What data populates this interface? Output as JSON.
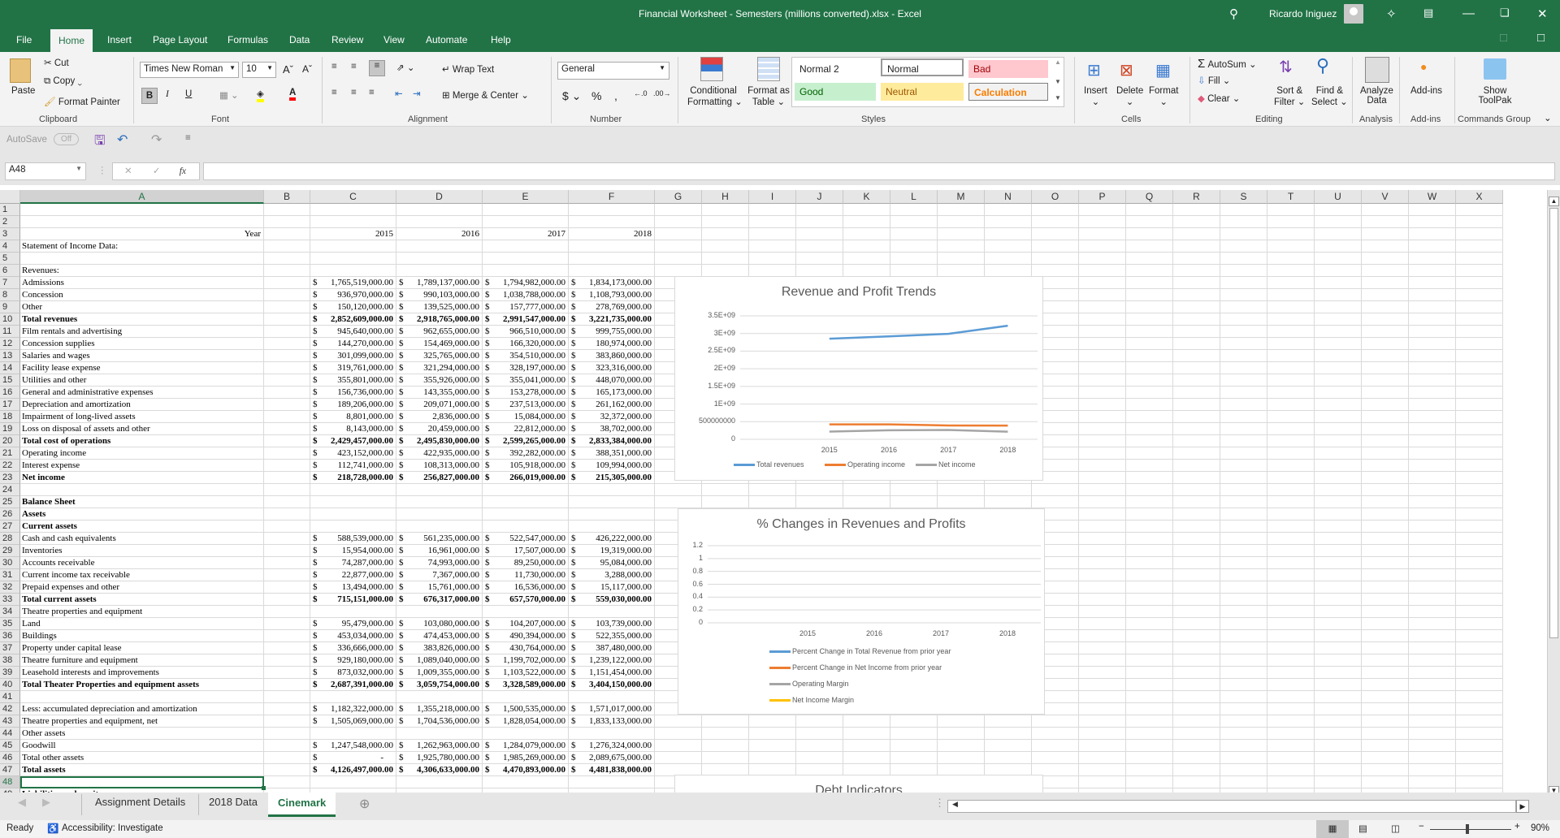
{
  "titlebar": {
    "title": "Financial Worksheet - Semesters (millions converted).xlsx  -  Excel",
    "user": "Ricardo Iniguez"
  },
  "menu": {
    "tabs": [
      "File",
      "Home",
      "Insert",
      "Page Layout",
      "Formulas",
      "Data",
      "Review",
      "View",
      "Automate",
      "Help"
    ],
    "active": "Home"
  },
  "ribbon": {
    "clipboard": {
      "paste": "Paste",
      "cut": "Cut",
      "copy": "Copy",
      "format_painter": "Format Painter",
      "label": "Clipboard"
    },
    "font": {
      "name": "Times New Roman",
      "size": "10",
      "label": "Font",
      "bold": "B",
      "italic": "I",
      "underline": "U"
    },
    "alignment": {
      "wrap": "Wrap Text",
      "merge": "Merge & Center",
      "label": "Alignment"
    },
    "number": {
      "format": "General",
      "label": "Number"
    },
    "styles": {
      "conditional": "Conditional",
      "conditional2": "Formatting",
      "format_table": "Format as",
      "format_table2": "Table",
      "cells": [
        "Normal 2",
        "Normal",
        "Bad",
        "Good",
        "Neutral",
        "Calculation"
      ],
      "label": "Styles"
    },
    "cells": {
      "insert": "Insert",
      "delete": "Delete",
      "format": "Format",
      "label": "Cells"
    },
    "editing": {
      "autosum": "AutoSum",
      "fill": "Fill",
      "clear": "Clear",
      "sort": "Sort &",
      "sort2": "Filter",
      "find": "Find &",
      "find2": "Select",
      "label": "Editing"
    },
    "analysis": {
      "analyze": "Analyze",
      "analyze2": "Data",
      "label": "Analysis"
    },
    "addins": {
      "addins": "Add-ins",
      "label": "Add-ins"
    },
    "commands": {
      "show": "Show",
      "show2": "ToolPak",
      "label": "Commands Group"
    }
  },
  "qat": {
    "autosave": "AutoSave",
    "autosave_state": "Off"
  },
  "formula": {
    "namebox": "A48",
    "fx": "fx",
    "value": ""
  },
  "columns": [
    "A",
    "B",
    "C",
    "D",
    "E",
    "F",
    "G",
    "H",
    "I",
    "J",
    "K",
    "L",
    "M",
    "N",
    "O",
    "P",
    "Q",
    "R",
    "S",
    "T",
    "U",
    "V",
    "W",
    "X"
  ],
  "sheet": {
    "rows": [
      {
        "n": 1,
        "label": "",
        "values": []
      },
      {
        "n": 2,
        "label": "",
        "values": []
      },
      {
        "n": 3,
        "label": "Year",
        "values": [
          "2015",
          "2016",
          "2017",
          "2018"
        ],
        "year": true
      },
      {
        "n": 4,
        "label": "Statement of Income Data:",
        "values": []
      },
      {
        "n": 5,
        "label": "",
        "values": []
      },
      {
        "n": 6,
        "label": "Revenues:",
        "values": []
      },
      {
        "n": 7,
        "label": "Admissions",
        "values": [
          "1,765,519,000.00",
          "1,789,137,000.00",
          "1,794,982,000.00",
          "1,834,173,000.00"
        ]
      },
      {
        "n": 8,
        "label": "Concession",
        "values": [
          "936,970,000.00",
          "990,103,000.00",
          "1,038,788,000.00",
          "1,108,793,000.00"
        ]
      },
      {
        "n": 9,
        "label": "Other",
        "values": [
          "150,120,000.00",
          "139,525,000.00",
          "157,777,000.00",
          "278,769,000.00"
        ]
      },
      {
        "n": 10,
        "label": "Total revenues",
        "bold": true,
        "values": [
          "2,852,609,000.00",
          "2,918,765,000.00",
          "2,991,547,000.00",
          "3,221,735,000.00"
        ]
      },
      {
        "n": 11,
        "label": "Film rentals and advertising",
        "values": [
          "945,640,000.00",
          "962,655,000.00",
          "966,510,000.00",
          "999,755,000.00"
        ]
      },
      {
        "n": 12,
        "label": "Concession supplies",
        "values": [
          "144,270,000.00",
          "154,469,000.00",
          "166,320,000.00",
          "180,974,000.00"
        ]
      },
      {
        "n": 13,
        "label": "Salaries and wages",
        "values": [
          "301,099,000.00",
          "325,765,000.00",
          "354,510,000.00",
          "383,860,000.00"
        ]
      },
      {
        "n": 14,
        "label": "Facility lease expense",
        "values": [
          "319,761,000.00",
          "321,294,000.00",
          "328,197,000.00",
          "323,316,000.00"
        ]
      },
      {
        "n": 15,
        "label": "Utilities and other",
        "values": [
          "355,801,000.00",
          "355,926,000.00",
          "355,041,000.00",
          "448,070,000.00"
        ]
      },
      {
        "n": 16,
        "label": "General and administrative expenses",
        "values": [
          "156,736,000.00",
          "143,355,000.00",
          "153,278,000.00",
          "165,173,000.00"
        ]
      },
      {
        "n": 17,
        "label": "Depreciation and amortization",
        "values": [
          "189,206,000.00",
          "209,071,000.00",
          "237,513,000.00",
          "261,162,000.00"
        ]
      },
      {
        "n": 18,
        "label": "Impairment of long-lived assets",
        "values": [
          "8,801,000.00",
          "2,836,000.00",
          "15,084,000.00",
          "32,372,000.00"
        ]
      },
      {
        "n": 19,
        "label": "Loss on disposal of assets and other",
        "values": [
          "8,143,000.00",
          "20,459,000.00",
          "22,812,000.00",
          "38,702,000.00"
        ]
      },
      {
        "n": 20,
        "label": "Total cost of operations",
        "bold": true,
        "values": [
          "2,429,457,000.00",
          "2,495,830,000.00",
          "2,599,265,000.00",
          "2,833,384,000.00"
        ]
      },
      {
        "n": 21,
        "label": "Operating income",
        "values": [
          "423,152,000.00",
          "422,935,000.00",
          "392,282,000.00",
          "388,351,000.00"
        ]
      },
      {
        "n": 22,
        "label": "Interest expense",
        "values": [
          "112,741,000.00",
          "108,313,000.00",
          "105,918,000.00",
          "109,994,000.00"
        ]
      },
      {
        "n": 23,
        "label": "Net income",
        "bold": true,
        "values": [
          "218,728,000.00",
          "256,827,000.00",
          "266,019,000.00",
          "215,305,000.00"
        ]
      },
      {
        "n": 24,
        "label": "",
        "values": []
      },
      {
        "n": 25,
        "label": "Balance Sheet",
        "bold": true,
        "values": []
      },
      {
        "n": 26,
        "label": "Assets",
        "bold": true,
        "values": []
      },
      {
        "n": 27,
        "label": "Current assets",
        "bold": true,
        "values": []
      },
      {
        "n": 28,
        "label": "Cash and cash equivalents",
        "values": [
          "588,539,000.00",
          "561,235,000.00",
          "522,547,000.00",
          "426,222,000.00"
        ]
      },
      {
        "n": 29,
        "label": "Inventories",
        "values": [
          "15,954,000.00",
          "16,961,000.00",
          "17,507,000.00",
          "19,319,000.00"
        ]
      },
      {
        "n": 30,
        "label": "Accounts receivable",
        "values": [
          "74,287,000.00",
          "74,993,000.00",
          "89,250,000.00",
          "95,084,000.00"
        ]
      },
      {
        "n": 31,
        "label": "Current income tax receivable",
        "values": [
          "22,877,000.00",
          "7,367,000.00",
          "11,730,000.00",
          "3,288,000.00"
        ]
      },
      {
        "n": 32,
        "label": "Prepaid expenses and other",
        "values": [
          "13,494,000.00",
          "15,761,000.00",
          "16,536,000.00",
          "15,117,000.00"
        ]
      },
      {
        "n": 33,
        "label": "Total current assets",
        "bold": true,
        "values": [
          "715,151,000.00",
          "676,317,000.00",
          "657,570,000.00",
          "559,030,000.00"
        ]
      },
      {
        "n": 34,
        "label": "Theatre properties and equipment",
        "values": []
      },
      {
        "n": 35,
        "label": "Land",
        "values": [
          "95,479,000.00",
          "103,080,000.00",
          "104,207,000.00",
          "103,739,000.00"
        ]
      },
      {
        "n": 36,
        "label": "Buildings",
        "values": [
          "453,034,000.00",
          "474,453,000.00",
          "490,394,000.00",
          "522,355,000.00"
        ]
      },
      {
        "n": 37,
        "label": "Property under capital lease",
        "values": [
          "336,666,000.00",
          "383,826,000.00",
          "430,764,000.00",
          "387,480,000.00"
        ]
      },
      {
        "n": 38,
        "label": "Theatre furniture and equipment",
        "values": [
          "929,180,000.00",
          "1,089,040,000.00",
          "1,199,702,000.00",
          "1,239,122,000.00"
        ]
      },
      {
        "n": 39,
        "label": "Leasehold interests and improvements",
        "values": [
          "873,032,000.00",
          "1,009,355,000.00",
          "1,103,522,000.00",
          "1,151,454,000.00"
        ]
      },
      {
        "n": 40,
        "label": "Total Theater Properties and equipment assets",
        "bold": true,
        "values": [
          "2,687,391,000.00",
          "3,059,754,000.00",
          "3,328,589,000.00",
          "3,404,150,000.00"
        ]
      },
      {
        "n": 41,
        "label": "",
        "values": []
      },
      {
        "n": 42,
        "label": "Less: accumulated depreciation and amortization",
        "values": [
          "1,182,322,000.00",
          "1,355,218,000.00",
          "1,500,535,000.00",
          "1,571,017,000.00"
        ]
      },
      {
        "n": 43,
        "label": "Theatre properties and equipment, net",
        "values": [
          "1,505,069,000.00",
          "1,704,536,000.00",
          "1,828,054,000.00",
          "1,833,133,000.00"
        ]
      },
      {
        "n": 44,
        "label": "Other assets",
        "values": []
      },
      {
        "n": 45,
        "label": "Goodwill",
        "values": [
          "1,247,548,000.00",
          "1,262,963,000.00",
          "1,284,079,000.00",
          "1,276,324,000.00"
        ]
      },
      {
        "n": 46,
        "label": "Total other assets",
        "values": [
          "-",
          "1,925,780,000.00",
          "1,985,269,000.00",
          "2,089,675,000.00"
        ]
      },
      {
        "n": 47,
        "label": "Total assets",
        "bold": true,
        "values": [
          "4,126,497,000.00",
          "4,306,633,000.00",
          "4,470,893,000.00",
          "4,481,838,000.00"
        ]
      },
      {
        "n": 48,
        "label": "",
        "values": [],
        "selected": true
      },
      {
        "n": 49,
        "label": "Liabilities and equity:",
        "bold": true,
        "values": []
      }
    ]
  },
  "chart_data": [
    {
      "type": "line",
      "title": "Revenue and Profit Trends",
      "categories": [
        "",
        "2015",
        "2016",
        "2017",
        "2018"
      ],
      "series": [
        {
          "name": "Total revenues",
          "color": "#5b9bd5",
          "values": [
            null,
            2852609000,
            2918765000,
            2991547000,
            3221735000
          ]
        },
        {
          "name": "Operating income",
          "color": "#ed7d31",
          "values": [
            null,
            423152000,
            422935000,
            392282000,
            388351000
          ]
        },
        {
          "name": "Net income",
          "color": "#a5a5a5",
          "values": [
            null,
            218728000,
            256827000,
            266019000,
            215305000
          ]
        }
      ],
      "yticks": [
        "0",
        "500000000",
        "1E+09",
        "1.5E+09",
        "2E+09",
        "2.5E+09",
        "3E+09",
        "3.5E+09"
      ],
      "ylim": [
        0,
        3500000000
      ],
      "legend": "bottom",
      "grid": true
    },
    {
      "type": "line",
      "title": "% Changes in Revenues and Profits",
      "categories": [
        "",
        "2015",
        "2016",
        "2017",
        "2018"
      ],
      "series": [
        {
          "name": "Percent Change in Total Revenue from prior year",
          "color": "#5b9bd5",
          "values": []
        },
        {
          "name": "Percent Change in Net Income from prior year",
          "color": "#ed7d31",
          "values": []
        },
        {
          "name": "Operating Margin",
          "color": "#a5a5a5",
          "values": []
        },
        {
          "name": "Net Income Margin",
          "color": "#ffc000",
          "values": []
        }
      ],
      "yticks": [
        "0",
        "0.2",
        "0.4",
        "0.6",
        "0.8",
        "1",
        "1.2"
      ],
      "ylim": [
        0,
        1.2
      ],
      "legend": "bottom",
      "grid": true
    },
    {
      "type": "line",
      "title": "Debt Indicators"
    }
  ],
  "sheettabs": {
    "tabs": [
      "Assignment Details",
      "2018 Data",
      "Cinemark"
    ],
    "active": "Cinemark"
  },
  "status": {
    "ready": "Ready",
    "accessibility": "Accessibility: Investigate",
    "zoom": "90%"
  }
}
